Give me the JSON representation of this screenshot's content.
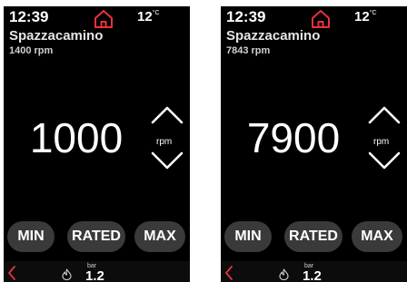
{
  "colors": {
    "background": "#000000",
    "accent": "#e8323c",
    "button": "#3a3a3a",
    "text": "#ffffff"
  },
  "screens": [
    {
      "clock": "12:39",
      "home_icon": "home-icon",
      "temperature": "12",
      "temperature_unit": "°C",
      "program_name": "Spazzacamino",
      "current_rpm": "1400 rpm",
      "setpoint": "1000",
      "unit": "rpm",
      "buttons": {
        "min": "MIN",
        "rated": "RATED",
        "max": "MAX"
      },
      "pressure_unit": "bar",
      "pressure_value": "1.2"
    },
    {
      "clock": "12:39",
      "home_icon": "home-icon",
      "temperature": "12",
      "temperature_unit": "°C",
      "program_name": "Spazzacamino",
      "current_rpm": "7843 rpm",
      "setpoint": "7900",
      "unit": "rpm",
      "buttons": {
        "min": "MIN",
        "rated": "RATED",
        "max": "MAX"
      },
      "pressure_unit": "bar",
      "pressure_value": "1.2"
    }
  ]
}
